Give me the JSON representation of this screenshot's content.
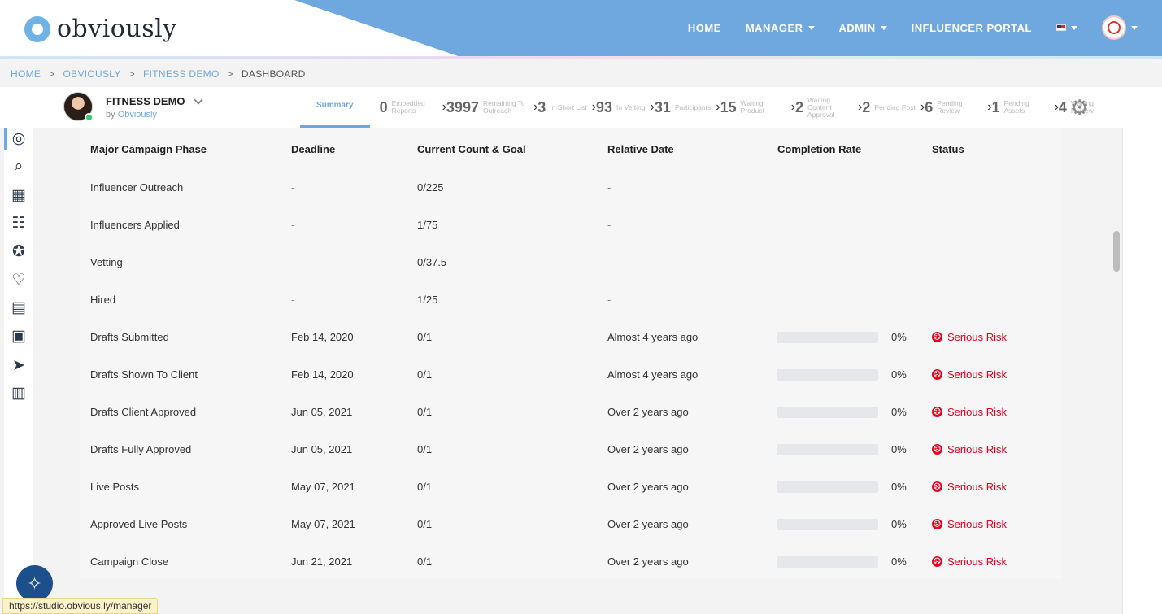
{
  "header": {
    "logo_text": "obviously",
    "nav": [
      {
        "label": "HOME",
        "dropdown": false
      },
      {
        "label": "MANAGER",
        "dropdown": true
      },
      {
        "label": "ADMIN",
        "dropdown": true
      },
      {
        "label": "INFLUENCER PORTAL",
        "dropdown": false
      }
    ],
    "language_icon": "us-flag-icon",
    "avatar_icon": "user-avatar-icon"
  },
  "breadcrumb": [
    "HOME",
    "OBVIOUSLY",
    "FITNESS DEMO",
    "DASHBOARD"
  ],
  "campaign": {
    "name": "FITNESS DEMO",
    "by_prefix": "by",
    "by_link": "Obviously",
    "summary_tab": "Summary",
    "steps": [
      {
        "num": "0",
        "label": "Embedded Reports"
      },
      {
        "num": "3997",
        "label": "Remaining To Outreach"
      },
      {
        "num": "3",
        "label": "In Short List"
      },
      {
        "num": "93",
        "label": "In Vetting"
      },
      {
        "num": "31",
        "label": "Participants"
      },
      {
        "num": "15",
        "label": "Waiting Product"
      },
      {
        "num": "2",
        "label": "Waiting Content Approval"
      },
      {
        "num": "2",
        "label": "Pending Post"
      },
      {
        "num": "6",
        "label": "Pending Review"
      },
      {
        "num": "1",
        "label": "Pending Assets"
      },
      {
        "num": "4",
        "label": "Waiting Review"
      }
    ]
  },
  "table": {
    "headers": [
      "Major Campaign Phase",
      "Deadline",
      "Current Count & Goal",
      "Relative Date",
      "Completion Rate",
      "Status"
    ],
    "rows": [
      {
        "phase": "Influencer Outreach",
        "deadline": "-",
        "count": "0/225",
        "relative": "-",
        "rate": null,
        "status": null
      },
      {
        "phase": "Influencers Applied",
        "deadline": "-",
        "count": "1/75",
        "relative": "-",
        "rate": null,
        "status": null
      },
      {
        "phase": "Vetting",
        "deadline": "-",
        "count": "0/37.5",
        "relative": "-",
        "rate": null,
        "status": null
      },
      {
        "phase": "Hired",
        "deadline": "-",
        "count": "1/25",
        "relative": "-",
        "rate": null,
        "status": null
      },
      {
        "phase": "Drafts Submitted",
        "deadline": "Feb 14, 2020",
        "count": "0/1",
        "relative": "Almost 4 years ago",
        "rate": "0%",
        "status": "Serious Risk"
      },
      {
        "phase": "Drafts Shown To Client",
        "deadline": "Feb 14, 2020",
        "count": "0/1",
        "relative": "Almost 4 years ago",
        "rate": "0%",
        "status": "Serious Risk"
      },
      {
        "phase": "Drafts Client Approved",
        "deadline": "Jun 05, 2021",
        "count": "0/1",
        "relative": "Over 2 years ago",
        "rate": "0%",
        "status": "Serious Risk"
      },
      {
        "phase": "Drafts Fully Approved",
        "deadline": "Jun 05, 2021",
        "count": "0/1",
        "relative": "Over 2 years ago",
        "rate": "0%",
        "status": "Serious Risk"
      },
      {
        "phase": "Live Posts",
        "deadline": "May 07, 2021",
        "count": "0/1",
        "relative": "Over 2 years ago",
        "rate": "0%",
        "status": "Serious Risk"
      },
      {
        "phase": "Approved Live Posts",
        "deadline": "May 07, 2021",
        "count": "0/1",
        "relative": "Over 2 years ago",
        "rate": "0%",
        "status": "Serious Risk"
      },
      {
        "phase": "Campaign Close",
        "deadline": "Jun 21, 2021",
        "count": "0/1",
        "relative": "Over 2 years ago",
        "rate": "0%",
        "status": "Serious Risk"
      }
    ]
  },
  "sidebar_icons": [
    "influencer-search-icon",
    "discover-search-icon",
    "products-icon",
    "checklist-icon",
    "approval-badge-icon",
    "favorites-icon",
    "content-icon",
    "content-review-icon",
    "outreach-send-icon",
    "analytics-icon"
  ],
  "colors": {
    "accent": "#6fa8de",
    "risk": "#e8001c"
  },
  "statusbar": {
    "url": "https://studio.obvious.ly/manager"
  }
}
